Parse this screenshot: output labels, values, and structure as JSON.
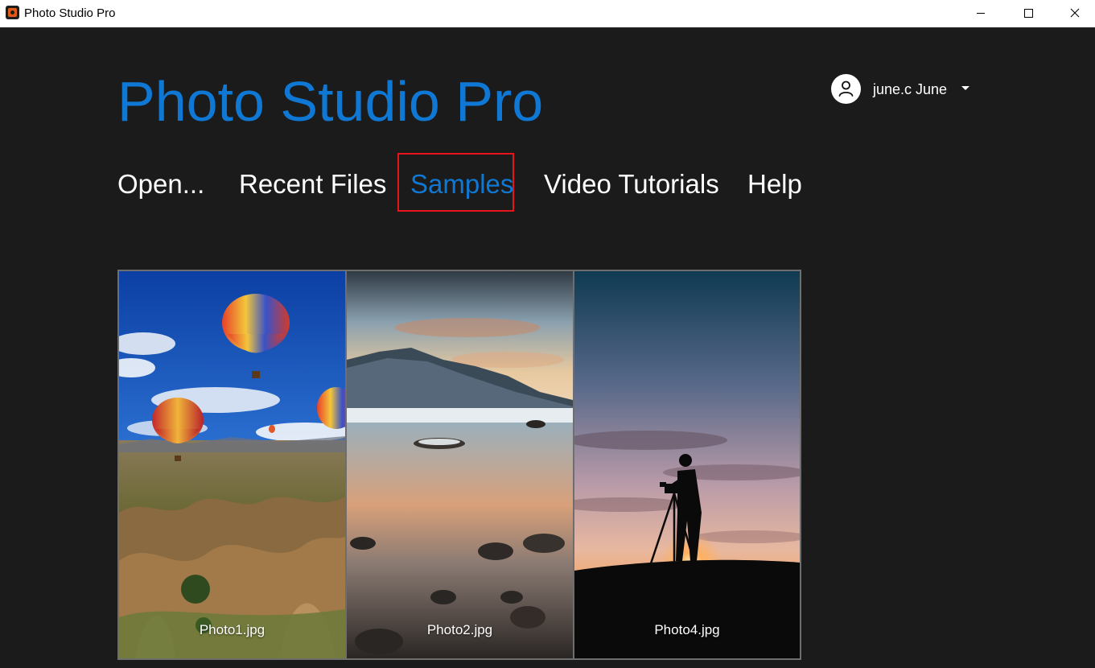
{
  "window": {
    "title": "Photo Studio Pro",
    "controls": {
      "minimize": "minimize-icon",
      "maximize": "maximize-icon",
      "close": "close-icon"
    }
  },
  "header": {
    "brand": "Photo Studio Pro",
    "user": {
      "name": "june.c June",
      "avatar_icon": "user-icon",
      "menu_icon": "caret-down-icon"
    }
  },
  "nav": {
    "items": [
      {
        "label": "Open..."
      },
      {
        "label": "Recent Files"
      },
      {
        "label": "Samples",
        "active": true
      },
      {
        "label": "Video Tutorials"
      },
      {
        "label": "Help"
      }
    ]
  },
  "gallery": {
    "photos": [
      {
        "label": "Photo1.jpg"
      },
      {
        "label": "Photo2.jpg"
      },
      {
        "label": "Photo4.jpg"
      }
    ]
  },
  "colors": {
    "accent": "#0f78d4",
    "highlight": "#e8141c",
    "background": "#1b1b1b"
  }
}
